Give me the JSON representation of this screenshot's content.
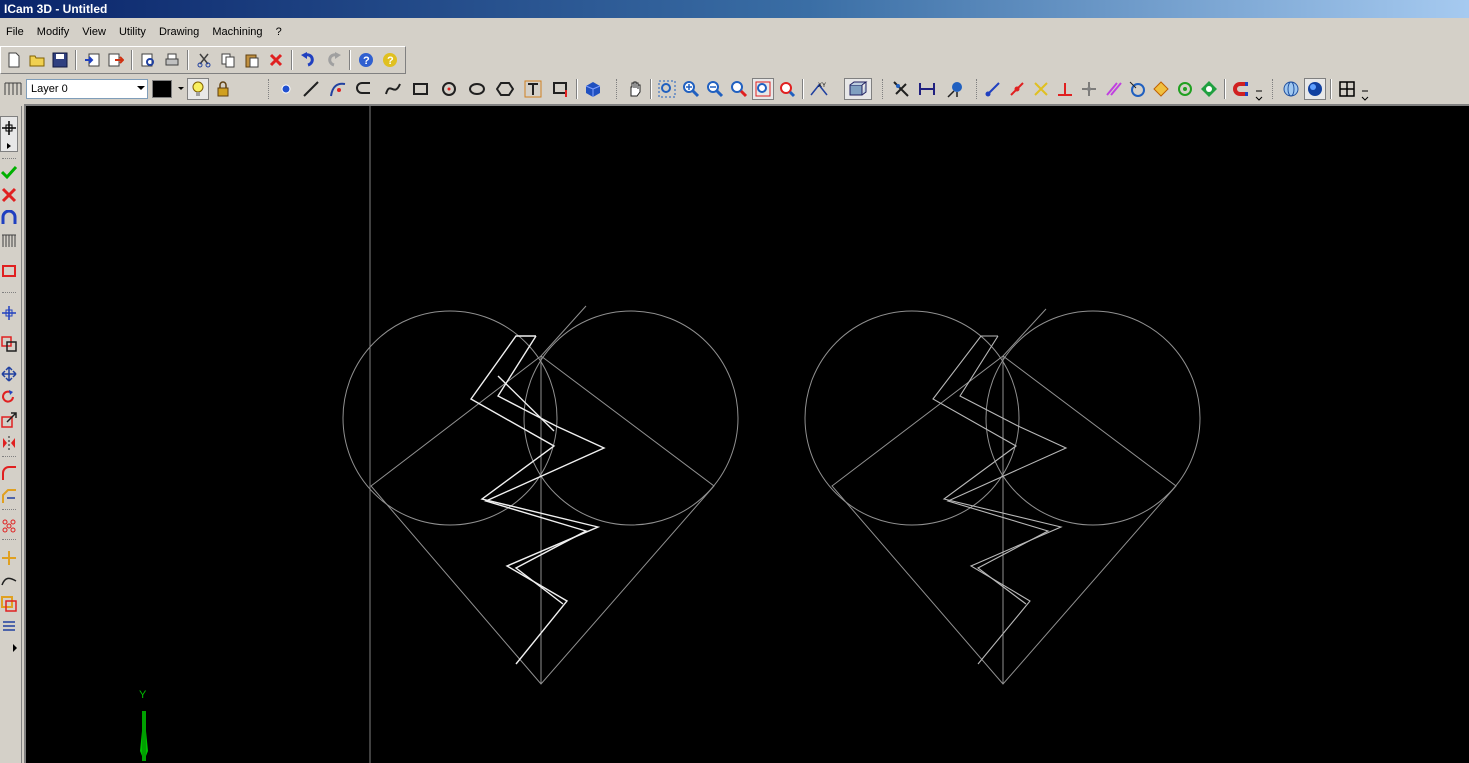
{
  "window": {
    "title": "ICam 3D - Untitled"
  },
  "menu": {
    "items": [
      {
        "label": "File"
      },
      {
        "label": "Modify"
      },
      {
        "label": "View"
      },
      {
        "label": "Utility"
      },
      {
        "label": "Drawing"
      },
      {
        "label": "Machining"
      },
      {
        "label": "?"
      }
    ]
  },
  "layer": {
    "selected": "Layer 0"
  },
  "viewport": {
    "background": "#000000",
    "y_axis_label": "Y"
  },
  "colors": {
    "accent_green": "#00c000",
    "delete_red": "#e02020",
    "title_blue": "#0a246a"
  }
}
